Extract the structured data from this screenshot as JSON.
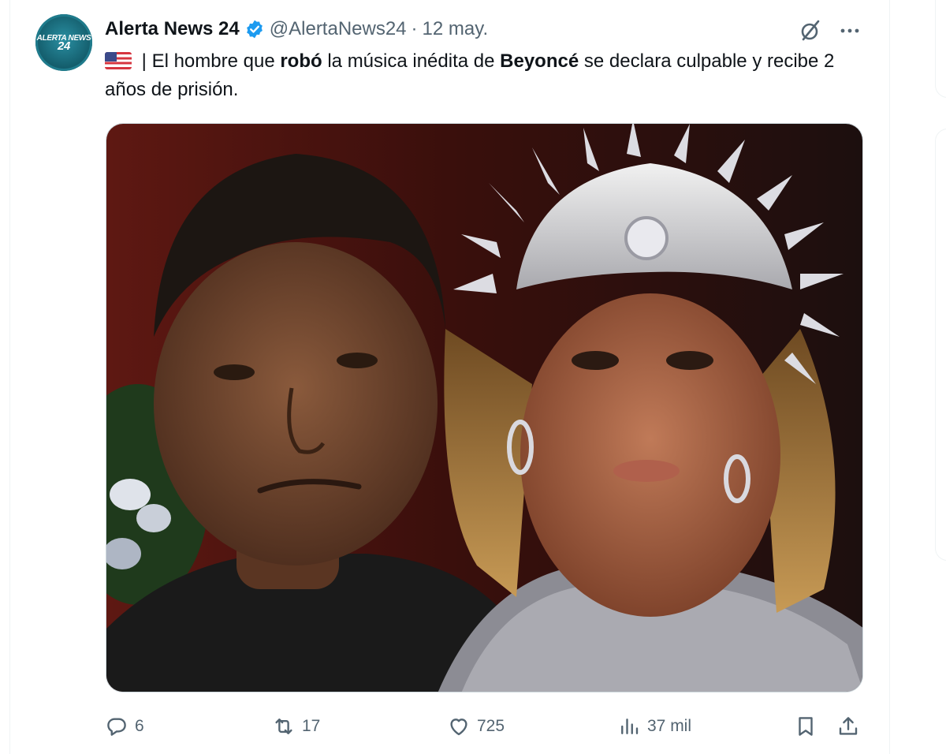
{
  "author": {
    "name": "Alerta News 24",
    "handle": "@AlertaNews24",
    "separator": "·",
    "date": "12 may.",
    "avatar_text_top": "ALERTA NEWS",
    "avatar_text_num": "24",
    "verified": true
  },
  "tweet": {
    "flag_icon": "us-flag-icon",
    "segments": [
      {
        "text": " | El hombre que ",
        "bold": false
      },
      {
        "text": "robó",
        "bold": true
      },
      {
        "text": " la música inédita de ",
        "bold": false
      },
      {
        "text": "Beyoncé",
        "bold": true
      },
      {
        "text": " se declara culpable y recibe 2 años de prisión.",
        "bold": false
      }
    ]
  },
  "actions": {
    "replies": "6",
    "retweets": "17",
    "likes": "725",
    "views": "37 mil"
  },
  "colors": {
    "text": "#0f1419",
    "secondary": "#536471",
    "verified": "#1d9bf0",
    "border": "#eff3f4"
  }
}
